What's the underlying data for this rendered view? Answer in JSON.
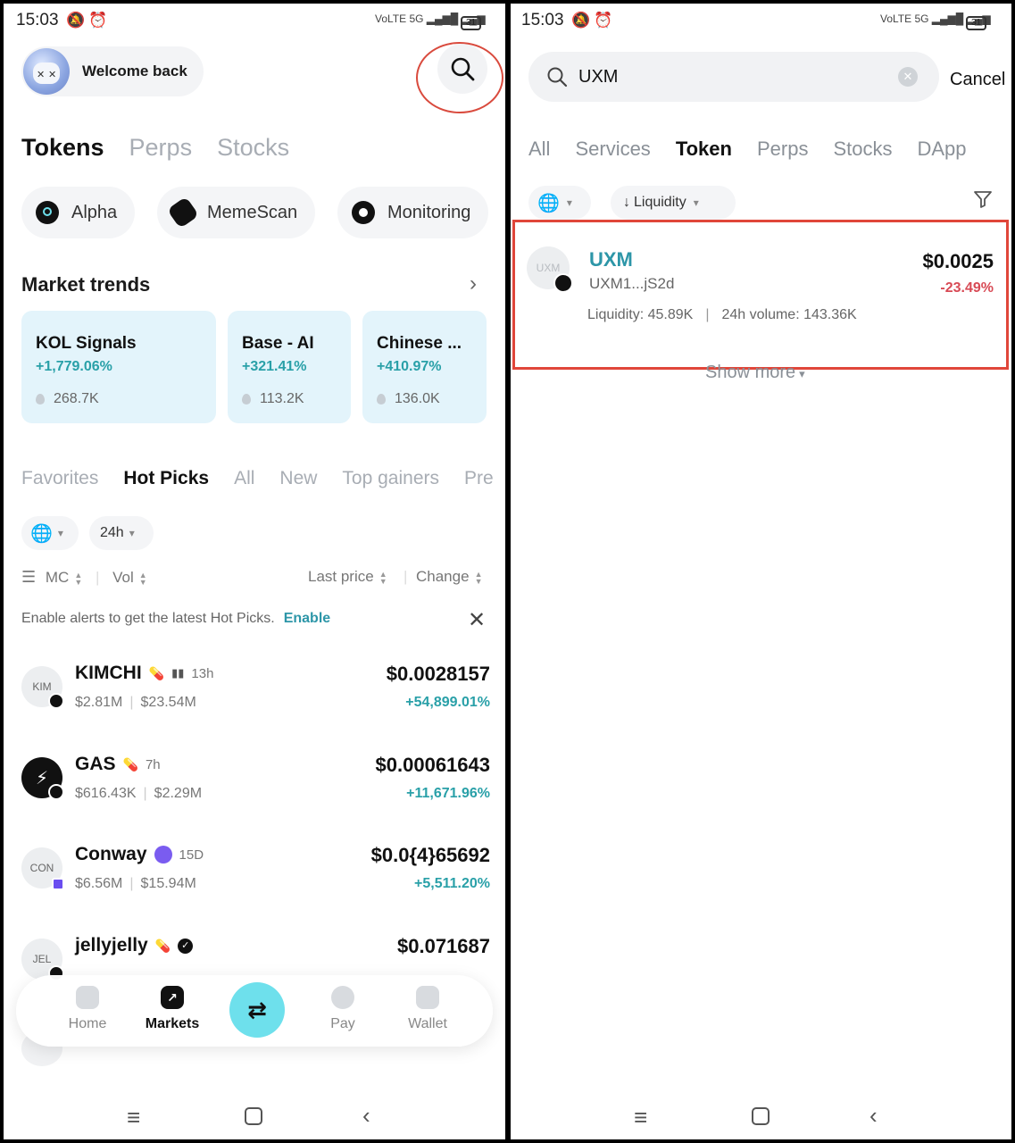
{
  "left": {
    "status": {
      "time": "15:03",
      "battery": "31"
    },
    "header": {
      "welcome": "Welcome back"
    },
    "main_tabs": [
      {
        "label": "Tokens",
        "active": true
      },
      {
        "label": "Perps",
        "active": false
      },
      {
        "label": "Stocks",
        "active": false
      }
    ],
    "chips": [
      "Alpha",
      "MemeScan",
      "Monitoring"
    ],
    "market_trends": {
      "title": "Market trends",
      "cards": [
        {
          "name": "KOL Signals",
          "change": "+1,779.06%",
          "volume": "268.7K"
        },
        {
          "name": "Base - AI",
          "change": "+321.41%",
          "volume": "113.2K"
        },
        {
          "name": "Chinese ...",
          "change": "+410.97%",
          "volume": "136.0K"
        }
      ]
    },
    "sub_tabs": [
      {
        "label": "Favorites",
        "active": false
      },
      {
        "label": "Hot Picks",
        "active": true
      },
      {
        "label": "All",
        "active": false
      },
      {
        "label": "New",
        "active": false
      },
      {
        "label": "Top gainers",
        "active": false
      },
      {
        "label": "Pre",
        "active": false
      }
    ],
    "filters": {
      "period": "24h"
    },
    "sort": {
      "mc": "MC",
      "vol": "Vol",
      "last_price": "Last price",
      "change": "Change"
    },
    "alert": {
      "text": "Enable alerts to get the latest Hot Picks.",
      "action": "Enable"
    },
    "tokens": [
      {
        "logo": "KIM",
        "name": "KIMCHI",
        "age": "13h",
        "mc": "$2.81M",
        "vol": "$23.54M",
        "price": "$0.0028157",
        "change": "+54,899.01%"
      },
      {
        "logo": "",
        "name": "GAS",
        "age": "7h",
        "mc": "$616.43K",
        "vol": "$2.29M",
        "price": "$0.00061643",
        "change": "+11,671.96%"
      },
      {
        "logo": "CON",
        "name": "Conway",
        "age": "15D",
        "mc": "$6.56M",
        "vol": "$15.94M",
        "price": "$0.0{4}65692",
        "change": "+5,511.20%"
      },
      {
        "logo": "JEL",
        "name": "jellyjelly",
        "age": "",
        "mc": "",
        "vol": "",
        "price": "$0.071687",
        "change": ""
      }
    ],
    "nav": [
      {
        "label": "Home",
        "active": false
      },
      {
        "label": "Markets",
        "active": true
      },
      {
        "label": "Pay",
        "active": false
      },
      {
        "label": "Wallet",
        "active": false
      }
    ]
  },
  "right": {
    "status": {
      "time": "15:03",
      "battery": "31"
    },
    "search": {
      "value": "UXM",
      "cancel": "Cancel"
    },
    "tabs": [
      {
        "label": "All",
        "active": false
      },
      {
        "label": "Services",
        "active": false
      },
      {
        "label": "Token",
        "active": true
      },
      {
        "label": "Perps",
        "active": false
      },
      {
        "label": "Stocks",
        "active": false
      },
      {
        "label": "DApp",
        "active": false
      }
    ],
    "sort_label": "Liquidity",
    "result": {
      "logo": "UXM",
      "name": "UXM",
      "address": "UXM1...jS2d",
      "price": "$0.0025",
      "change": "-23.49%",
      "liquidity": "Liquidity: 45.89K",
      "volume": "24h volume: 143.36K"
    },
    "show_more": "Show more"
  },
  "colors": {
    "accent_teal": "#2d96a8",
    "positive": "#29a0a8",
    "negative": "#d84a55",
    "highlight_red": "#e0463a",
    "trend_card_bg": "#e3f4fb",
    "swap_button": "#6ee0ec"
  }
}
